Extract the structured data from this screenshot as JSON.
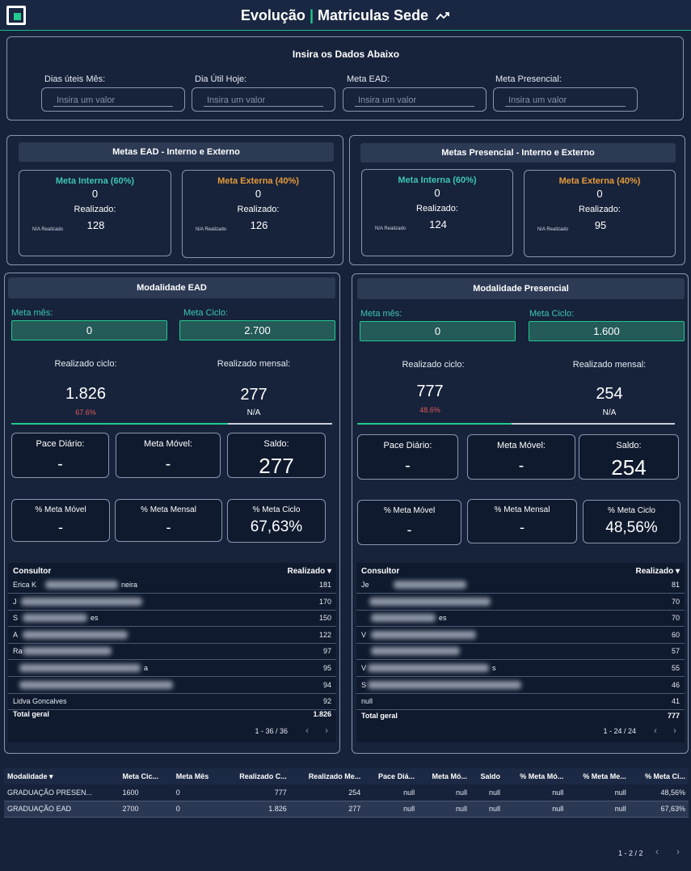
{
  "header": {
    "title_a": "Evolução",
    "sep": "|",
    "title_b": "Matriculas Sede",
    "icon": "trending-icon"
  },
  "inputs": {
    "title": "Insira os Dados Abaixo",
    "fields": [
      {
        "label": "Dias úteis Mês:",
        "placeholder": "Insira um valor"
      },
      {
        "label": "Dia Útil Hoje:",
        "placeholder": "Insira um valor"
      },
      {
        "label": "Meta EAD:",
        "placeholder": "Insira um valor"
      },
      {
        "label": "Meta Presencial:",
        "placeholder": "Insira um valor"
      }
    ]
  },
  "metas_ead": {
    "title": "Metas EAD - Interno e Externo",
    "interna": {
      "label": "Meta Interna (60%)",
      "value": "0",
      "realizado_label": "Realizado:",
      "realizado": "128",
      "na": "N/A Realizado"
    },
    "externa": {
      "label": "Meta Externa (40%)",
      "value": "0",
      "realizado_label": "Realizado:",
      "realizado": "126",
      "na": "N/A Realizado"
    }
  },
  "metas_pres": {
    "title": "Metas Presencial - Interno e Externo",
    "interna": {
      "label": "Meta Interna (60%)",
      "value": "0",
      "realizado_label": "Realizado:",
      "realizado": "124",
      "na": "N/A Realizado"
    },
    "externa": {
      "label": "Meta Externa (40%)",
      "value": "0",
      "realizado_label": "Realizado:",
      "realizado": "95",
      "na": "N/A Realizado"
    }
  },
  "ead": {
    "title": "Modalidade EAD",
    "meta_mes_label": "Meta mês:",
    "meta_mes": "0",
    "meta_ciclo_label": "Meta Ciclo:",
    "meta_ciclo": "2.700",
    "realizado_ciclo_label": "Realizado ciclo:",
    "realizado_ciclo": "1.826",
    "realizado_ciclo_pct": "67.6%",
    "realizado_mensal_label": "Realizado mensal:",
    "realizado_mensal": "277",
    "mensal_note": "N/A",
    "progress": 0.676,
    "pace_label": "Pace Diário:",
    "pace": "-",
    "meta_movel_label": "Meta Móvel:",
    "meta_movel": "-",
    "saldo_label": "Saldo:",
    "saldo": "277",
    "pct_movel_label": "% Meta Móvel",
    "pct_movel": "-",
    "pct_mensal_label": "% Meta Mensal",
    "pct_mensal": "-",
    "pct_ciclo_label": "% Meta Ciclo",
    "pct_ciclo": "67,63%",
    "table": {
      "col1": "Consultor",
      "col2": "Realizado ▾",
      "rows": [
        {
          "name": "Erica K",
          "tail": "neira",
          "value": "181"
        },
        {
          "name": "J",
          "tail": "",
          "value": "170"
        },
        {
          "name": "S",
          "tail": "es",
          "value": "150"
        },
        {
          "name": "A",
          "tail": "",
          "value": "122"
        },
        {
          "name": "Ra",
          "tail": "",
          "value": "97"
        },
        {
          "name": "",
          "tail": "a",
          "value": "95"
        },
        {
          "name": "",
          "tail": "",
          "value": "94"
        },
        {
          "name": "Lidva Goncalves",
          "tail": "",
          "value": "92"
        }
      ],
      "total_label": "Total geral",
      "total": "1.826",
      "pager": "1 - 36 / 36"
    }
  },
  "pres": {
    "title": "Modalidade Presencial",
    "meta_mes_label": "Meta mês:",
    "meta_mes": "0",
    "meta_ciclo_label": "Meta Ciclo:",
    "meta_ciclo": "1.600",
    "realizado_ciclo_label": "Realizado ciclo:",
    "realizado_ciclo": "777",
    "realizado_ciclo_pct": "48.6%",
    "realizado_mensal_label": "Realizado mensal:",
    "realizado_mensal": "254",
    "mensal_note": "N/A",
    "progress": 0.486,
    "pace_label": "Pace Diário:",
    "pace": "-",
    "meta_movel_label": "Meta Móvel:",
    "meta_movel": "-",
    "saldo_label": "Saldo:",
    "saldo": "254",
    "pct_movel_label": "% Meta Móvel",
    "pct_movel": "-",
    "pct_mensal_label": "% Meta Mensal",
    "pct_mensal": "-",
    "pct_ciclo_label": "% Meta Ciclo",
    "pct_ciclo": "48,56%",
    "table": {
      "col1": "Consultor",
      "col2": "Realizado ▾",
      "rows": [
        {
          "name": "Je",
          "tail": "",
          "value": "81"
        },
        {
          "name": "",
          "tail": "",
          "value": "70"
        },
        {
          "name": "",
          "tail": "es",
          "value": "70"
        },
        {
          "name": "V",
          "tail": "",
          "value": "60"
        },
        {
          "name": "",
          "tail": "",
          "value": "57"
        },
        {
          "name": "V",
          "tail": "s",
          "value": "55"
        },
        {
          "name": "S",
          "tail": "",
          "value": "46"
        },
        {
          "name": "null",
          "tail": "",
          "value": "41"
        }
      ],
      "total_label": "Total geral",
      "total": "777",
      "pager": "1 - 24 / 24"
    }
  },
  "bottom": {
    "headers": [
      "Modalidade ▾",
      "Meta Cic...",
      "Meta Mês",
      "Realizado C...",
      "Realizado Me...",
      "Pace Diá...",
      "Meta Mó...",
      "Saldo",
      "% Meta Mó...",
      "% Meta Me...",
      "% Meta Ci..."
    ],
    "rows": [
      [
        "GRADUAÇÃO PRESEN...",
        "1600",
        "0",
        "777",
        "254",
        "null",
        "null",
        "null",
        "null",
        "null",
        "48,56%"
      ],
      [
        "GRADUAÇÃO EAD",
        "2700",
        "0",
        "1.826",
        "277",
        "null",
        "null",
        "null",
        "null",
        "null",
        "67,63%"
      ]
    ],
    "pager": "1 - 2 / 2"
  },
  "colors": {
    "accent": "#22c98f",
    "teal": "#3ec6b0",
    "orange": "#e59a3a",
    "bg": "#16223a"
  }
}
